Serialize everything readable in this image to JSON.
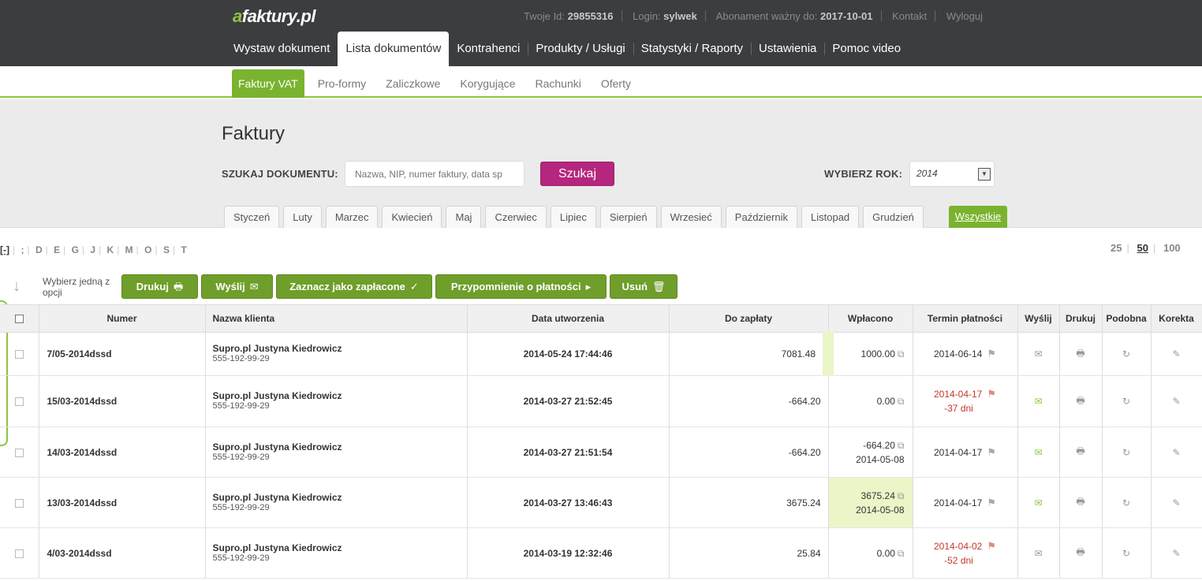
{
  "header": {
    "logo_a": "a",
    "logo_rest": "faktury.pl",
    "id_label": "Twoje Id:",
    "id_value": "29855316",
    "login_label": "Login:",
    "login_value": "sylwek",
    "sub_label": "Abonament ważny do:",
    "sub_value": "2017-10-01",
    "contact": "Kontakt",
    "logout": "Wyloguj"
  },
  "mainnav": [
    "Wystaw dokument",
    "Lista dokumentów",
    "Kontrahenci",
    "Produkty / Usługi",
    "Statystyki / Raporty",
    "Ustawienia",
    "Pomoc video"
  ],
  "subnav": [
    "Faktury VAT",
    "Pro-formy",
    "Zaliczkowe",
    "Korygujące",
    "Rachunki",
    "Oferty"
  ],
  "page": {
    "title": "Faktury",
    "search_label": "SZUKAJ DOKUMENTU:",
    "search_placeholder": "Nazwa, NIP, numer faktury, data sp",
    "search_button": "Szukaj",
    "year_label": "WYBIERZ ROK:",
    "year_value": "2014"
  },
  "months": [
    "Styczeń",
    "Luty",
    "Marzec",
    "Kwiecień",
    "Maj",
    "Czerwiec",
    "Lipiec",
    "Sierpień",
    "Wrzesieć",
    "Październik",
    "Listopad",
    "Grudzień"
  ],
  "all_tab": "Wszystkie",
  "letters": [
    "[-]",
    ";",
    "D",
    "E",
    "G",
    "J",
    "K",
    "M",
    "O",
    "S",
    "T"
  ],
  "perpage": [
    "25",
    "50",
    "100"
  ],
  "actions": {
    "choose_text": "Wybierz jedną z opcji",
    "print": "Drukuj",
    "send": "Wyślij",
    "mark_paid": "Zaznacz jako zapłacone",
    "reminder": "Przypomnienie o płatności",
    "delete": "Usuń"
  },
  "table": {
    "headers": {
      "number": "Numer",
      "client": "Nazwa klienta",
      "created": "Data utworzenia",
      "to_pay": "Do zapłaty",
      "paid": "Wpłacono",
      "due": "Termin płatności",
      "send": "Wyślij",
      "print": "Drukuj",
      "similar": "Podobna",
      "correct": "Korekta"
    },
    "rows": [
      {
        "number": "7/05-2014dssd",
        "client": "Supro.pl Justyna Kiedrowicz",
        "phone": "555-192-99-29",
        "created": "2014-05-24 17:44:46",
        "to_pay": "7081.48",
        "paid": "1000.00",
        "paid_date": "",
        "due": "2014-06-14",
        "overdue": ""
      },
      {
        "number": "15/03-2014dssd",
        "client": "Supro.pl Justyna Kiedrowicz",
        "phone": "555-192-99-29",
        "created": "2014-03-27 21:52:45",
        "to_pay": "-664.20",
        "paid": "0.00",
        "paid_date": "",
        "due": "2014-04-17",
        "overdue": "-37 dni"
      },
      {
        "number": "14/03-2014dssd",
        "client": "Supro.pl Justyna Kiedrowicz",
        "phone": "555-192-99-29",
        "created": "2014-03-27 21:51:54",
        "to_pay": "-664.20",
        "paid": "-664.20",
        "paid_date": "2014-05-08",
        "due": "2014-04-17",
        "overdue": ""
      },
      {
        "number": "13/03-2014dssd",
        "client": "Supro.pl Justyna Kiedrowicz",
        "phone": "555-192-99-29",
        "created": "2014-03-27 13:46:43",
        "to_pay": "3675.24",
        "paid": "3675.24",
        "paid_date": "2014-05-08",
        "due": "2014-04-17",
        "overdue": ""
      },
      {
        "number": "4/03-2014dssd",
        "client": "Supro.pl Justyna Kiedrowicz",
        "phone": "555-192-99-29",
        "created": "2014-03-19 12:32:46",
        "to_pay": "25.84",
        "paid": "0.00",
        "paid_date": "",
        "due": "2014-04-02",
        "overdue": "-52 dni"
      }
    ]
  },
  "colors": {
    "accent_green": "#7ab32f",
    "search_button": "#b5267e",
    "topbar": "#3c3d3f"
  }
}
